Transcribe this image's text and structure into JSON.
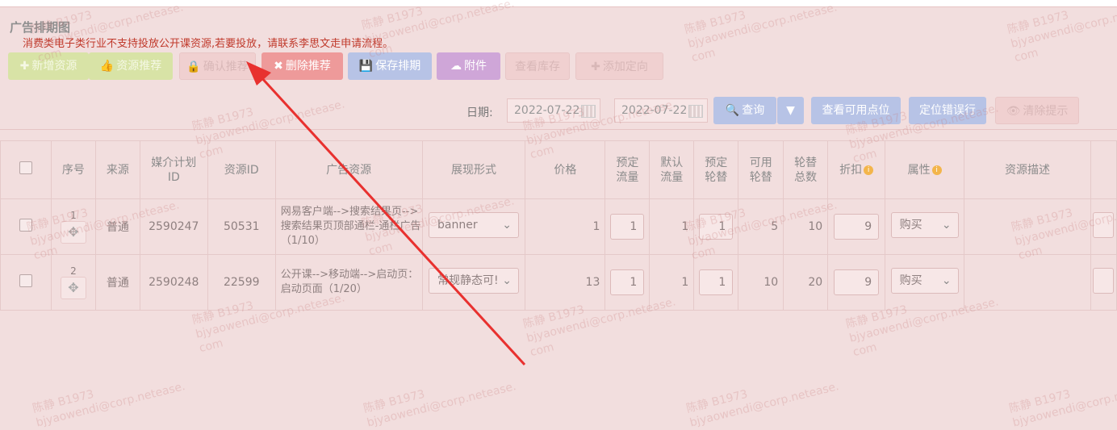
{
  "page": {
    "title": "广告排期图",
    "warning": "消费类电子类行业不支持投放公开课资源,若要投放，请联系李思文走申请流程。"
  },
  "toolbar": {
    "new_resource": "新增资源",
    "recommend_resource": "资源推荐",
    "hidden_btn": "确认推荐",
    "delete_recommend": "删除推荐",
    "save_schedule": "保存排期",
    "attachment": "附件",
    "view_stock": "查看库存",
    "hidden_btn2": "添加定向"
  },
  "filter": {
    "date_label": "日期:",
    "date_start": "2022-07-22",
    "date_end": "2022-07-22",
    "query": "查询",
    "view_available": "查看可用点位",
    "locate_error": "定位错误行",
    "clear_tips": "清除提示"
  },
  "table": {
    "headers": [
      "序号",
      "来源",
      "媒介计划ID",
      "资源ID",
      "广告资源",
      "展现形式",
      "价格",
      "预定流量",
      "默认流量",
      "预定轮替",
      "可用轮替",
      "轮替总数",
      "折扣",
      "属性",
      "资源描述"
    ],
    "rows": [
      {
        "seq": "1",
        "source": "普通",
        "plan_id": "2590247",
        "resource_id": "50531",
        "ad_resource": "网易客户端-->搜索结果页-->搜索结果页顶部通栏-通栏广告（1/10）",
        "format": "banner",
        "price": "1",
        "booked_flow": "1",
        "default_flow": "1",
        "booked_rotation": "1",
        "available_rotation": "5",
        "total_rotation": "10",
        "discount": "9",
        "attribute": "购买"
      },
      {
        "seq": "2",
        "source": "普通",
        "plan_id": "2590248",
        "resource_id": "22599",
        "ad_resource": "公开课-->移动端-->启动页：启动页面（1/20）",
        "format": "常规静态可!",
        "price": "13",
        "booked_flow": "1",
        "default_flow": "1",
        "booked_rotation": "1",
        "available_rotation": "10",
        "total_rotation": "20",
        "discount": "9",
        "attribute": "购买"
      }
    ]
  },
  "watermark": {
    "name": "陈静 B1973",
    "email1": "bjyaowendi@corp.netease.",
    "email2": "com"
  },
  "colors": {
    "overlay": "#f2dede",
    "arrow": "#e8312f"
  }
}
